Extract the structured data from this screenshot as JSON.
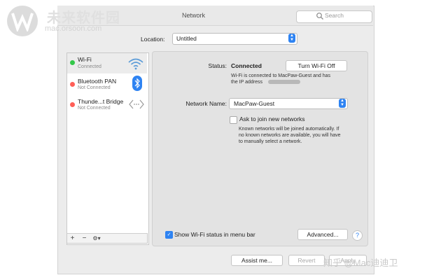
{
  "window": {
    "title": "Network"
  },
  "search": {
    "placeholder": "Search"
  },
  "location": {
    "label": "Location:",
    "value": "Untitled"
  },
  "services": [
    {
      "name": "Wi-Fi",
      "status": "Connected",
      "dot_color": "#34c84a",
      "icon": "wifi-icon"
    },
    {
      "name": "Bluetooth PAN",
      "status": "Not Connected",
      "dot_color": "#ff5f57",
      "icon": "bluetooth-icon"
    },
    {
      "name": "Thunde...t Bridge",
      "status": "Not Connected",
      "dot_color": "#ff5f57",
      "icon": "thunderbolt-bridge-icon"
    }
  ],
  "sidebar_toolbar": {
    "add": "+",
    "remove": "−",
    "action": "⚙▾"
  },
  "detail": {
    "status_label": "Status:",
    "status_value": "Connected",
    "turn_off_button": "Turn Wi-Fi Off",
    "status_description_1": "Wi-Fi is connected to MacPaw-Guest and has",
    "status_description_2": "the IP address",
    "network_name_label": "Network Name:",
    "network_name_value": "MacPaw-Guest",
    "ask_to_join_label": "Ask to join new networks",
    "ask_to_join_checked": false,
    "ask_desc_1": "Known networks will be joined automatically. If",
    "ask_desc_2": "no known networks are available, you will have",
    "ask_desc_3": "to manually select a network."
  },
  "footer": {
    "show_status_label": "Show Wi-Fi status in menu bar",
    "show_status_checked": true,
    "advanced_button": "Advanced...",
    "help_button": "?",
    "assist_button": "Assist me...",
    "revert_button": "Revert",
    "apply_button": "Apply"
  },
  "colors": {
    "accent": "#2e83f2",
    "connected": "#34c84a",
    "disconnected": "#ff5f57"
  },
  "watermark": {
    "site_name": "未来软件园",
    "site_url": "mac.orsoon.com",
    "credit": "知乎 @Mac迪迪卫"
  }
}
